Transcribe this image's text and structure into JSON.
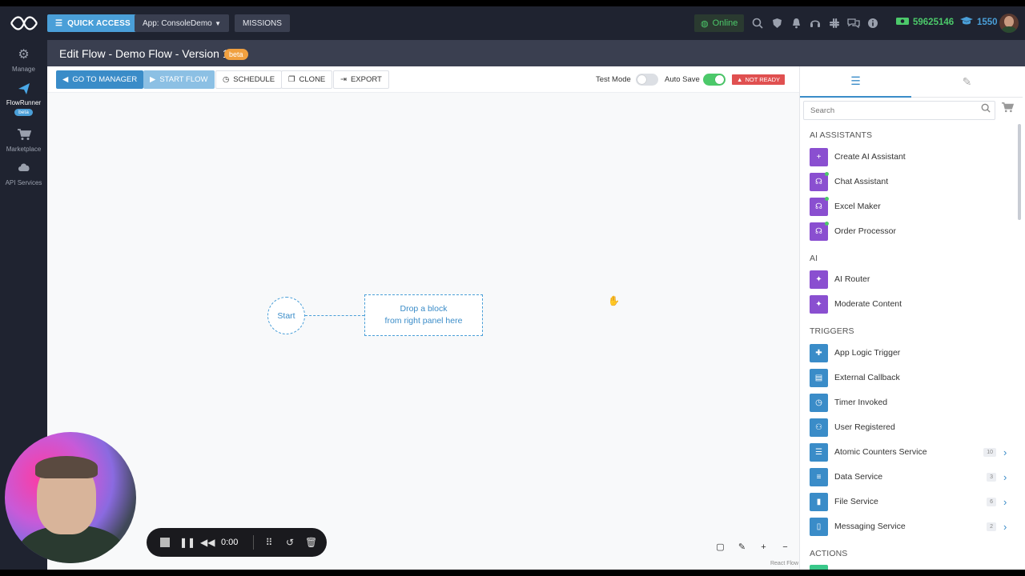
{
  "topbar": {
    "quick_access": "QUICK ACCESS",
    "app_select": "App: ConsoleDemo",
    "missions": "MISSIONS",
    "online": "Online",
    "credits": "59625146",
    "points": "1550"
  },
  "leftnav": {
    "items": [
      {
        "label": "Manage",
        "icon": "gear-icon"
      },
      {
        "label": "FlowRunner",
        "icon": "paper-plane-icon",
        "badge": "beta"
      },
      {
        "label": "Marketplace",
        "icon": "cart-icon"
      },
      {
        "label": "API Services",
        "icon": "cloud-icon"
      }
    ]
  },
  "header": {
    "title": "Edit Flow - Demo Flow - Version 1",
    "badge": "beta"
  },
  "toolbar": {
    "go_to_manager": "GO TO MANAGER",
    "start_flow": "START FLOW",
    "schedule": "SCHEDULE",
    "clone": "CLONE",
    "export": "EXPORT",
    "test_mode": "Test Mode",
    "auto_save": "Auto Save",
    "status": "NOT READY"
  },
  "canvas": {
    "start_label": "Start",
    "drop_line1": "Drop a block",
    "drop_line2": "from right panel here",
    "attribution": "React Flow"
  },
  "panel": {
    "search_placeholder": "Search",
    "sections": {
      "ai_assistants": "AI ASSISTANTS",
      "ai": "AI",
      "triggers": "TRIGGERS",
      "actions": "ACTIONS"
    },
    "ai_assistants": [
      "Create AI Assistant",
      "Chat Assistant",
      "Excel Maker",
      "Order Processor"
    ],
    "ai": [
      "AI Router",
      "Moderate Content"
    ],
    "triggers": [
      "App Logic Trigger",
      "External Callback",
      "Timer Invoked",
      "User Registered"
    ],
    "services": [
      {
        "label": "Atomic Counters Service",
        "count": "10"
      },
      {
        "label": "Data Service",
        "count": "3"
      },
      {
        "label": "File Service",
        "count": "6"
      },
      {
        "label": "Messaging Service",
        "count": "2"
      }
    ]
  },
  "player": {
    "time": "0:00"
  },
  "colors": {
    "accent": "#3a8cc8",
    "ai_purple": "#8a4fd0",
    "online_green": "#4cc96a",
    "not_ready_red": "#e05050",
    "header_bg": "#3a3f50",
    "nav_bg": "#1f2330"
  }
}
